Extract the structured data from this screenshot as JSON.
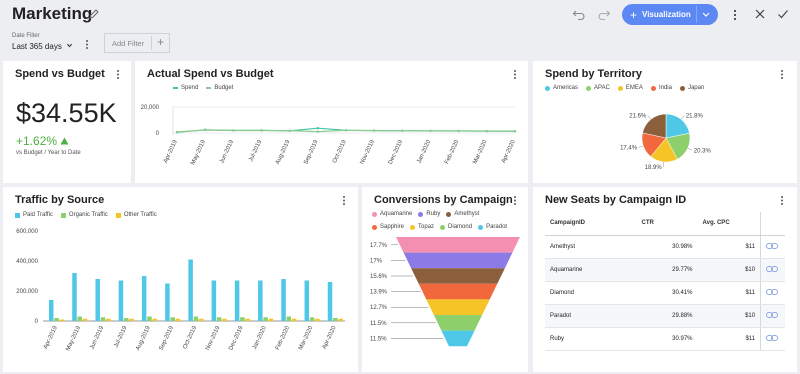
{
  "header": {
    "title": "Marketing",
    "visualization_label": "Visualization"
  },
  "filters": {
    "date_filter_label": "Date Filter",
    "date_filter_value": "Last 365 days",
    "add_filter_label": "Add Filter"
  },
  "colors": {
    "accent": "#5b88f2",
    "kpi_positive": "#4db042",
    "spend_line": "#45c5a6",
    "budget_line": "#8bc98e"
  },
  "kpi_card": {
    "title": "Spend vs Budget",
    "value": "$34.55K",
    "change": "+1.62%",
    "change_icon": "triangle-up-icon",
    "caption": "vs Budget / Year to Date"
  },
  "spend_chart": {
    "title": "Actual Spend vs Budget",
    "chart_data": {
      "type": "line",
      "categories": [
        "Apr-2019",
        "May-2019",
        "Jun-2019",
        "Jul-2019",
        "Aug-2019",
        "Sep-2019",
        "Oct-2019",
        "Nov-2019",
        "Dec-2019",
        "Jan-2020",
        "Feb-2020",
        "Mar-2020",
        "Apr-2020"
      ],
      "series": [
        {
          "name": "Spend",
          "color": "#45c5a6",
          "values": [
            500,
            2500,
            1900,
            2100,
            1600,
            3700,
            2000,
            1800,
            1700,
            1600,
            1500,
            1400,
            1300
          ]
        },
        {
          "name": "Budget",
          "color": "#8bc98e",
          "values": [
            800,
            2300,
            2000,
            1900,
            1800,
            1100,
            2100,
            1900,
            1800,
            1700,
            1600,
            1500,
            1400
          ]
        }
      ],
      "yticks": [
        "20,000",
        "0"
      ],
      "ylim": [
        0,
        20000
      ],
      "grid": true,
      "legend": "top"
    }
  },
  "territory_chart": {
    "title": "Spend by Territory",
    "chart_data": {
      "type": "pie",
      "categories": [
        "Americas",
        "APAC",
        "EMEA",
        "India",
        "Japan"
      ],
      "colors": [
        "#4fc8e8",
        "#8dd06b",
        "#f5c527",
        "#f0683c",
        "#8b5e3c"
      ],
      "values": [
        21.8,
        20.3,
        18.9,
        17.4,
        21.6
      ],
      "labels": [
        "21.8%",
        "20.3%",
        "18.9%",
        "17.4%",
        "21.6%"
      ],
      "legend": "top"
    }
  },
  "traffic_chart": {
    "title": "Traffic by Source",
    "chart_data": {
      "type": "bar",
      "categories": [
        "Apr-2019",
        "May-2019",
        "Jun-2019",
        "Jul-2019",
        "Aug-2019",
        "Sep-2019",
        "Oct-2019",
        "Nov-2019",
        "Dec-2019",
        "Jan-2020",
        "Feb-2020",
        "Mar-2020",
        "Apr-2020"
      ],
      "series": [
        {
          "name": "Paid Traffic",
          "color": "#4fc8e8",
          "values": [
            140000,
            320000,
            280000,
            270000,
            300000,
            250000,
            410000,
            270000,
            270000,
            270000,
            280000,
            270000,
            260000
          ]
        },
        {
          "name": "Organic Traffic",
          "color": "#8dd06b",
          "values": [
            20000,
            30000,
            25000,
            20000,
            30000,
            25000,
            30000,
            25000,
            25000,
            25000,
            30000,
            25000,
            20000
          ]
        },
        {
          "name": "Other Traffic",
          "color": "#f5c527",
          "values": [
            10000,
            15000,
            15000,
            15000,
            15000,
            15000,
            15000,
            15000,
            15000,
            15000,
            15000,
            15000,
            15000
          ]
        }
      ],
      "yticks": [
        "600,000",
        "400,000",
        "200,000",
        "0"
      ],
      "ylim": [
        0,
        600000
      ],
      "legend": "top"
    }
  },
  "conversions_chart": {
    "title": "Conversions by Campaign",
    "chart_data": {
      "type": "funnel",
      "categories": [
        "Aquamarine",
        "Ruby",
        "Amethyst",
        "Sapphire",
        "Topaz",
        "Diamond",
        "Paradot"
      ],
      "colors": [
        "#f48fb1",
        "#8c7ae6",
        "#8b5e3c",
        "#f0683c",
        "#f5c527",
        "#8dd06b",
        "#4fc8e8"
      ],
      "values": [
        17.7,
        17,
        15.6,
        13.9,
        12.7,
        11.5,
        11.5
      ],
      "labels": [
        "17.7%",
        "17%",
        "15.6%",
        "13.9%",
        "12.7%",
        "11.5%",
        "11.5%"
      ],
      "legend": "top"
    }
  },
  "seats_table": {
    "title": "New Seats by Campaign ID",
    "columns": [
      "CampaignID",
      "CTR",
      "Avg. CPC"
    ],
    "rows": [
      {
        "id": "Amethyst",
        "ctr": "30.98%",
        "cpc": "$11"
      },
      {
        "id": "Aquamarine",
        "ctr": "29.77%",
        "cpc": "$10"
      },
      {
        "id": "Diamond",
        "ctr": "30.41%",
        "cpc": "$11"
      },
      {
        "id": "Paradot",
        "ctr": "29.88%",
        "cpc": "$10"
      },
      {
        "id": "Ruby",
        "ctr": "30.97%",
        "cpc": "$11"
      }
    ]
  }
}
